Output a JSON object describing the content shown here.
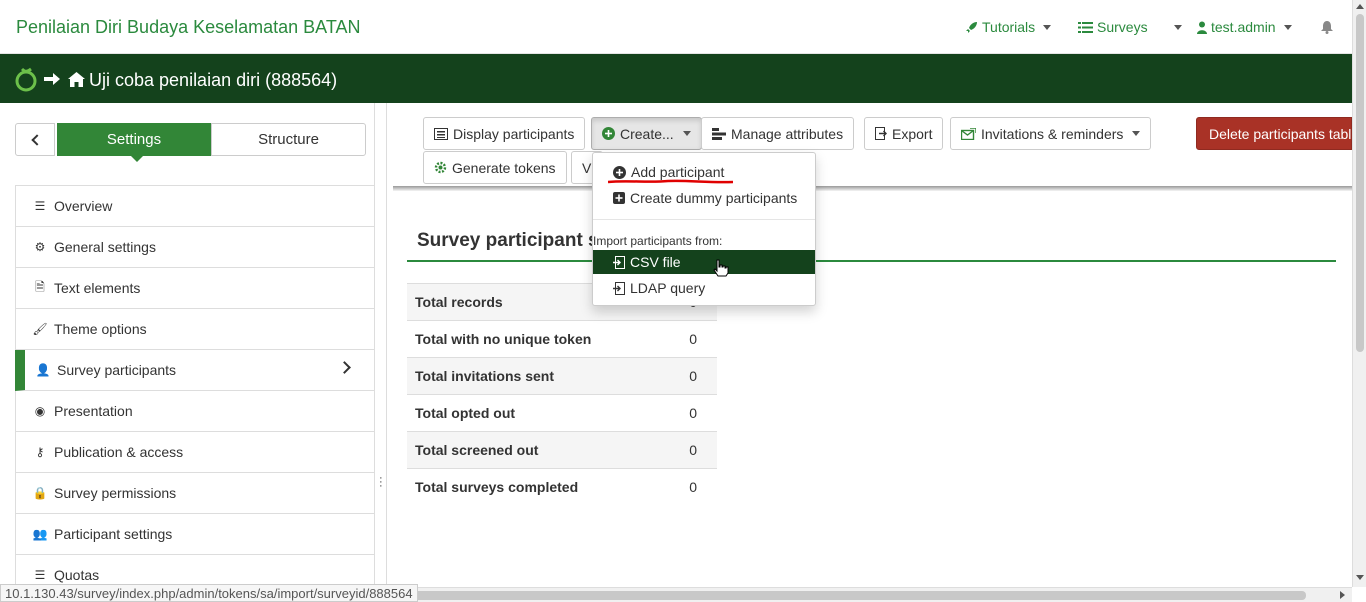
{
  "topbar": {
    "brand": "Penilaian Diri Budaya Keselamatan BATAN",
    "tutorials": "Tutorials",
    "surveys": "Surveys",
    "user": "test.admin"
  },
  "surveybar": {
    "title": "Uji coba penilaian diri (888564)"
  },
  "sidebar": {
    "tabs": {
      "settings": "Settings",
      "structure": "Structure"
    },
    "items": [
      {
        "label": "Overview",
        "icon": "list-icon"
      },
      {
        "label": "General settings",
        "icon": "cogs-icon"
      },
      {
        "label": "Text elements",
        "icon": "file-text-icon"
      },
      {
        "label": "Theme options",
        "icon": "paint-brush-icon"
      },
      {
        "label": "Survey participants",
        "icon": "user-icon"
      },
      {
        "label": "Presentation",
        "icon": "eye-slash-icon"
      },
      {
        "label": "Publication & access",
        "icon": "key-icon"
      },
      {
        "label": "Survey permissions",
        "icon": "lock-icon"
      },
      {
        "label": "Participant settings",
        "icon": "users-icon"
      },
      {
        "label": "Quotas",
        "icon": "tasks-icon"
      }
    ]
  },
  "toolbar": {
    "display_participants": "Display participants",
    "create": "Create...",
    "manage_attributes": "Manage attributes",
    "export": "Export",
    "invitations": "Invitations & reminders",
    "delete_table": "Delete participants tabl",
    "generate_tokens": "Generate tokens",
    "view_partial": "V"
  },
  "dropdown": {
    "add_participant": "Add participant",
    "create_dummy": "Create dummy participants",
    "import_header": "Import participants from:",
    "csv_file": "CSV file",
    "ldap_query": "LDAP query"
  },
  "summary": {
    "title": "Survey participant s",
    "rows": [
      {
        "label": "Total records",
        "value": "0"
      },
      {
        "label": "Total with no unique token",
        "value": "0"
      },
      {
        "label": "Total invitations sent",
        "value": "0"
      },
      {
        "label": "Total opted out",
        "value": "0"
      },
      {
        "label": "Total screened out",
        "value": "0"
      },
      {
        "label": "Total surveys completed",
        "value": "0"
      }
    ]
  },
  "status_url": "10.1.130.43/survey/index.php/admin/tokens/sa/import/surveyid/888564",
  "colors": {
    "brand_green": "#2b8a3e",
    "dark_green": "#14421c",
    "danger": "#a93226"
  }
}
